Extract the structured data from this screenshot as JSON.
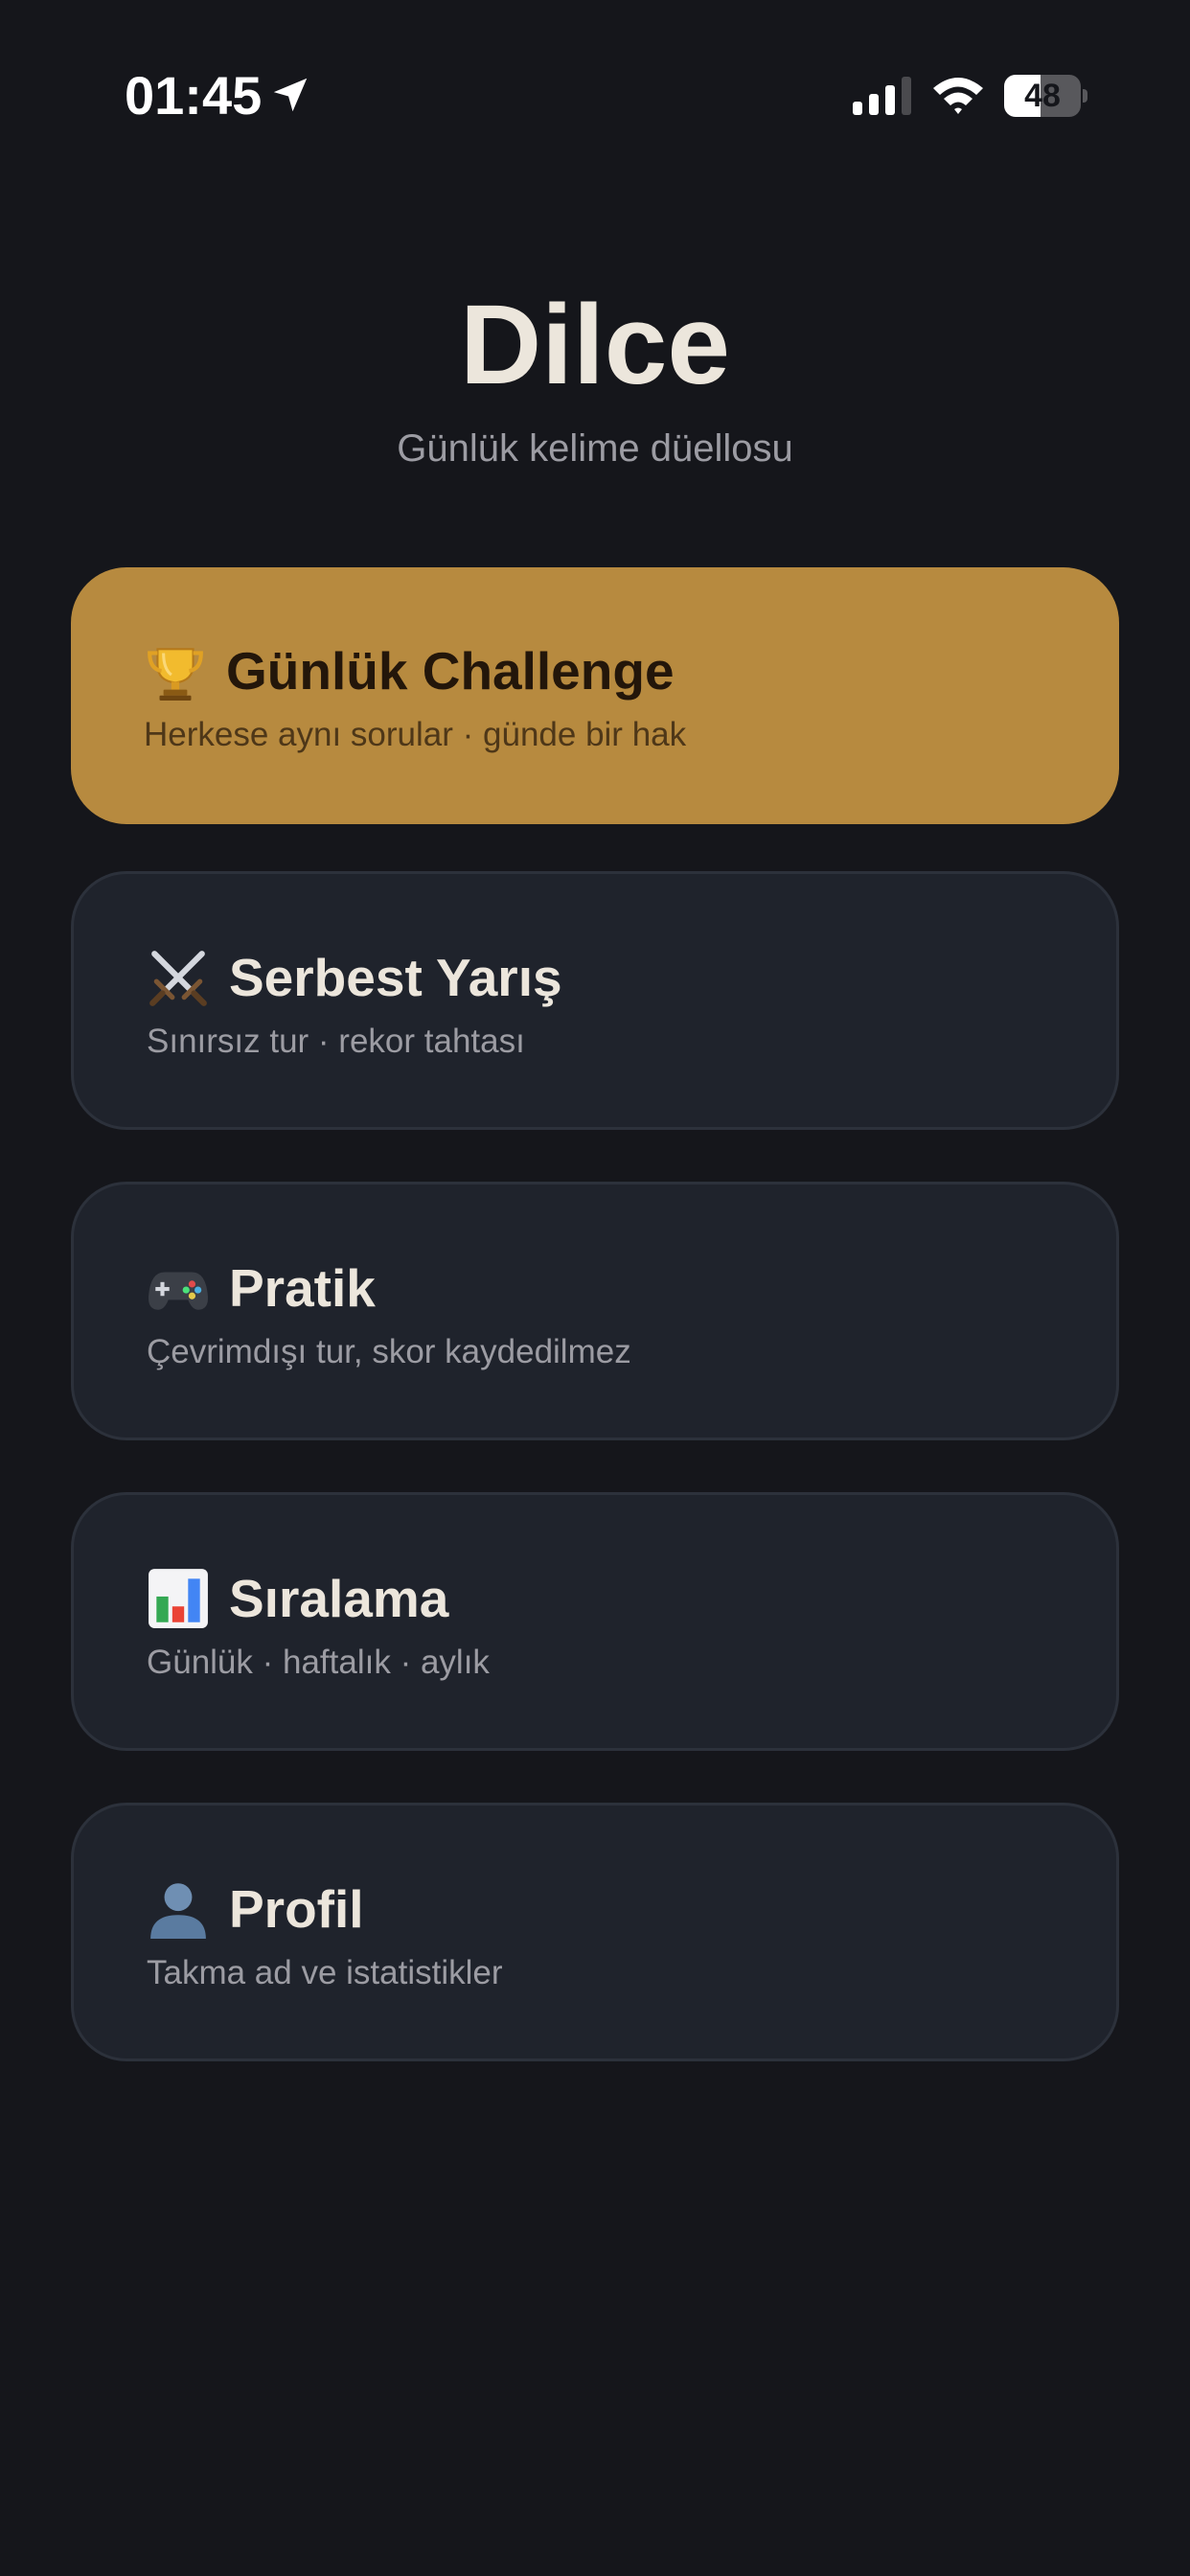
{
  "status_bar": {
    "time": "01:45",
    "battery_level": "48",
    "battery_fraction": 0.48
  },
  "header": {
    "title": "Dilce",
    "subtitle": "Günlük kelime düellosu"
  },
  "menu": [
    {
      "title": "Günlük Challenge",
      "subtitle": "Herkese aynı sorular · günde bir hak",
      "icon": "trophy-icon",
      "accent": "#b78a3f"
    },
    {
      "title": "Serbest Yarış",
      "subtitle": "Sınırsız tur · rekor tahtası",
      "icon": "crossed-swords-icon"
    },
    {
      "title": "Pratik",
      "subtitle": "Çevrimdışı tur, skor kaydedilmez",
      "icon": "game-controller-icon"
    },
    {
      "title": "Sıralama",
      "subtitle": "Günlük · haftalık · aylık",
      "icon": "bar-chart-icon"
    },
    {
      "title": "Profil",
      "subtitle": "Takma ad ve istatistikler",
      "icon": "user-silhouette-icon"
    }
  ],
  "colors": {
    "background": "#15161b",
    "card": "#1f232c",
    "accent": "#b78a3f",
    "text": "#ece6dc",
    "muted": "#9c9ca3"
  }
}
